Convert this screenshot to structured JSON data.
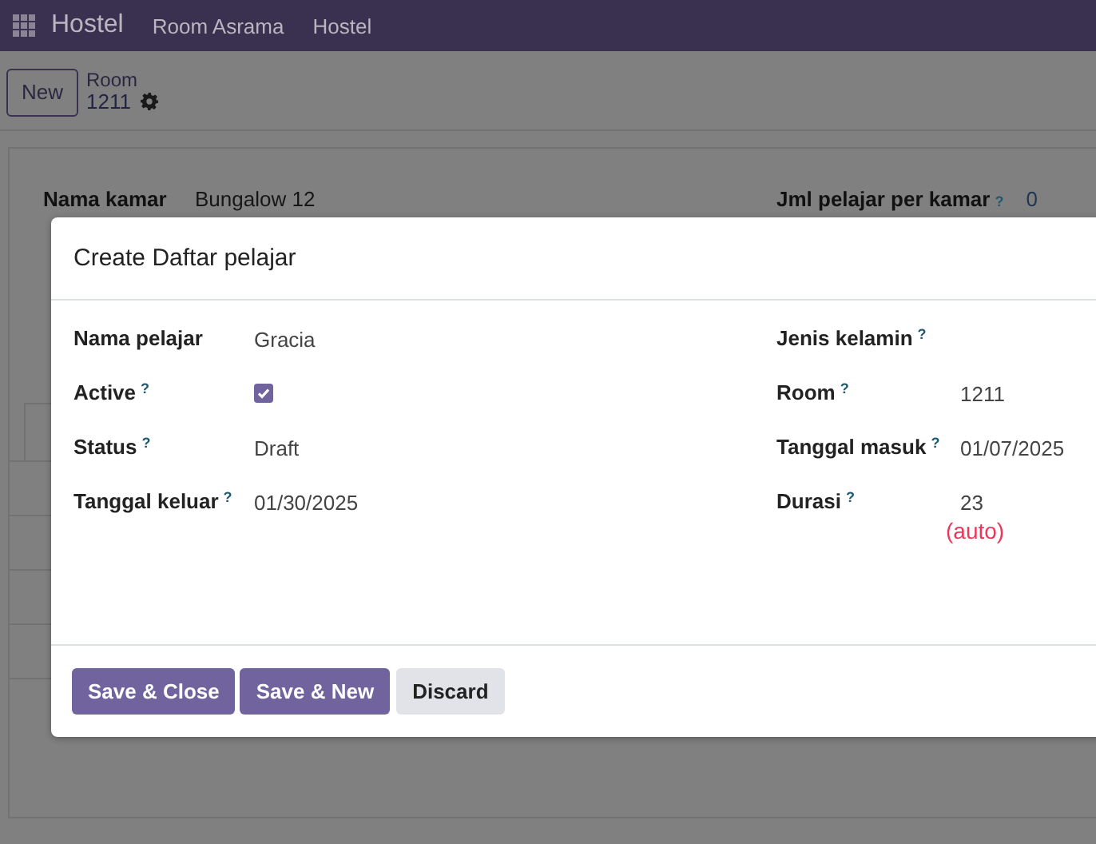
{
  "navbar": {
    "app_name": "Hostel",
    "menu": [
      "Room Asrama",
      "Hostel"
    ]
  },
  "control_panel": {
    "new_button": "New",
    "breadcrumb": "Room",
    "record": "1211"
  },
  "form": {
    "fields": [
      {
        "label": "Nama kamar",
        "value": "Bungalow 12"
      },
      {
        "label": "Jml pelajar per kamar",
        "help": "?",
        "value": "0"
      }
    ]
  },
  "dialog": {
    "title": "Create Daftar pelajar",
    "left_fields": [
      {
        "kind": "text",
        "label": "Nama pelajar",
        "value": "Gracia"
      },
      {
        "kind": "checkbox",
        "label": "Active",
        "help": "?",
        "checked": true
      },
      {
        "kind": "text",
        "label": "Status",
        "help": "?",
        "value": "Draft"
      },
      {
        "kind": "text",
        "label": "Tanggal keluar",
        "help": "?",
        "value": "01/30/2025"
      }
    ],
    "right_fields": [
      {
        "kind": "text",
        "label": "Jenis kelamin",
        "help": "?"
      },
      {
        "kind": "text",
        "label": "Room",
        "help": "?",
        "value": "1211"
      },
      {
        "kind": "text",
        "label": "Tanggal masuk",
        "help": "?",
        "value": "01/07/2025"
      },
      {
        "kind": "text",
        "label": "Durasi",
        "help": "?",
        "value": "23",
        "note": "(auto)"
      }
    ],
    "buttons": [
      {
        "label": "Save & Close",
        "kind": "primary"
      },
      {
        "label": "Save & New",
        "kind": "primary"
      },
      {
        "label": "Discard",
        "kind": "secondary"
      }
    ]
  }
}
